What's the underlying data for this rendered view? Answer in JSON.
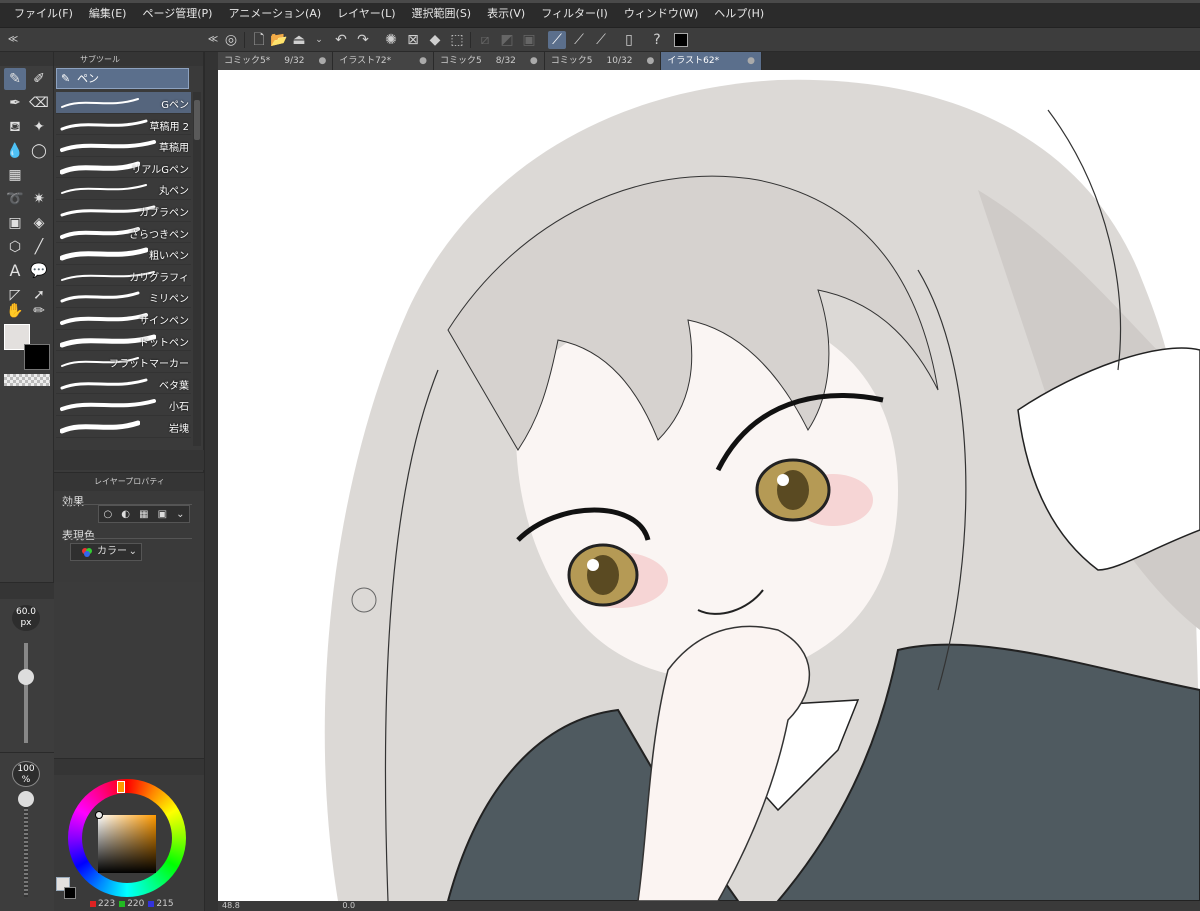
{
  "menu": [
    "ファイル(F)",
    "編集(E)",
    "ページ管理(P)",
    "アニメーション(A)",
    "レイヤー(L)",
    "選択範囲(S)",
    "表示(V)",
    "フィルター(I)",
    "ウィンドウ(W)",
    "ヘルプ(H)"
  ],
  "subtool_panel": {
    "tab_label": "サブツール",
    "group_label": "ペン",
    "brushes": [
      "Gペン",
      "草稿用 2",
      "草稿用",
      "リアルGペン",
      "丸ペン",
      "カブラペン",
      "ざらつきペン",
      "粗いペン",
      "カリグラフィ",
      "ミリペン",
      "サインペン",
      "ドットペン",
      "フラットマーカー",
      "ベタ葉",
      "小石",
      "岩塊"
    ]
  },
  "layer_property": {
    "tab_label": "レイヤープロパティ",
    "effect_label": "効果",
    "expression_label": "表現色",
    "expression_value": "カラー"
  },
  "brush_size": {
    "value": "60.0",
    "unit": "px"
  },
  "opacity": {
    "value": "100",
    "unit": "%"
  },
  "color": {
    "r": "223",
    "g": "220",
    "b": "215",
    "fg_hex": "#dfdcd7",
    "bg_hex": "#000000"
  },
  "doc_tabs": [
    {
      "name": "コミック5*",
      "page": "9/32",
      "active": false
    },
    {
      "name": "イラスト72*",
      "page": "",
      "active": false
    },
    {
      "name": "コミック5",
      "page": "8/32",
      "active": false
    },
    {
      "name": "コミック5",
      "page": "10/32",
      "active": false
    },
    {
      "name": "イラスト62*",
      "page": "",
      "active": true
    }
  ],
  "status": {
    "zoom": "48.8",
    "rotation": "0.0"
  },
  "colors": {
    "accent": "#5b6f8c",
    "panel": "#3a3a3a",
    "menubar": "#2b2b2b"
  }
}
